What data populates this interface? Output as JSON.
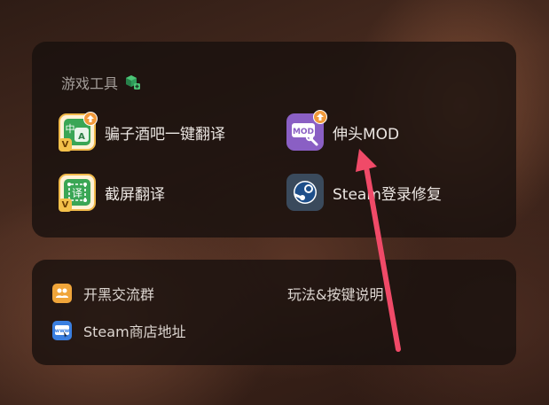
{
  "tools_panel": {
    "title": "游戏工具",
    "tools": [
      {
        "label": "骗子酒吧一键翻译",
        "icon": "translate-icon"
      },
      {
        "label": "伸头MOD",
        "icon": "mod-icon"
      },
      {
        "label": "截屏翻译",
        "icon": "screenshot-translate-icon"
      },
      {
        "label": "Steam登录修复",
        "icon": "steam-icon"
      }
    ],
    "icon_text": {
      "zhong": "中",
      "a": "A",
      "v": "V",
      "yi": "译",
      "mod": "MOD"
    }
  },
  "links_panel": {
    "links": [
      {
        "label": "开黑交流群",
        "icon": "group-icon"
      },
      {
        "label": "玩法&按键说明",
        "icon": ""
      },
      {
        "label": "Steam商店地址",
        "icon": "www-icon"
      }
    ],
    "www_text": "www"
  },
  "colors": {
    "accent_arrow": "#f04a68",
    "badge_orange": "#f29a3b",
    "badge_gold": "#f3c04a",
    "mod_purple": "#8a5fc4",
    "translate_green": "#3aa655"
  }
}
